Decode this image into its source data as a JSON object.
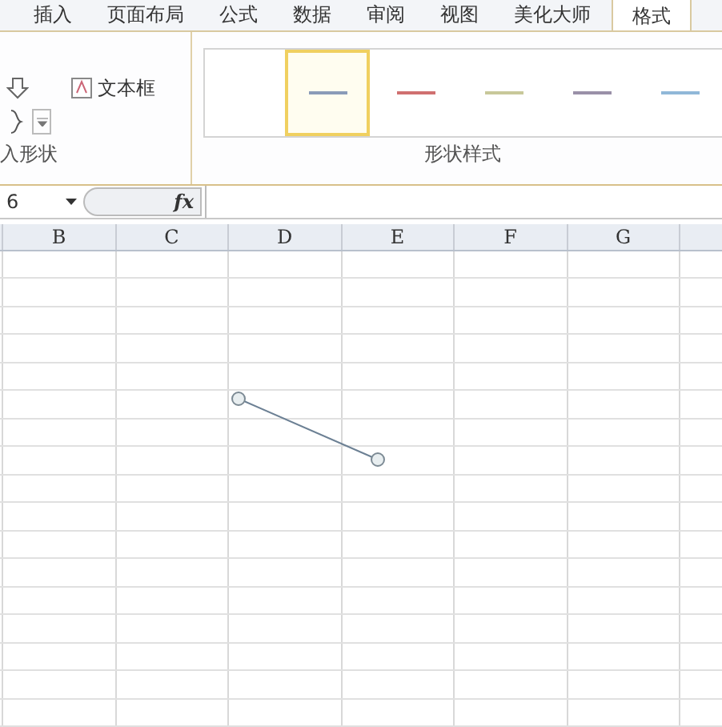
{
  "tabs": [
    {
      "label": "插入",
      "selected": false
    },
    {
      "label": "页面布局",
      "selected": false
    },
    {
      "label": "公式",
      "selected": false
    },
    {
      "label": "数据",
      "selected": false
    },
    {
      "label": "审阅",
      "selected": false
    },
    {
      "label": "视图",
      "selected": false
    },
    {
      "label": "美化大师",
      "selected": false
    },
    {
      "label": "格式",
      "selected": true
    }
  ],
  "insert_shapes": {
    "text_box_button": "文本框",
    "group_label": "入形状"
  },
  "shape_styles": {
    "items": [
      {
        "color": "#8a9bb8",
        "selected": true
      },
      {
        "color": "#d07070",
        "selected": false
      },
      {
        "color": "#c8c89a",
        "selected": false
      },
      {
        "color": "#9a90a8",
        "selected": false
      },
      {
        "color": "#90b8d8",
        "selected": false
      }
    ],
    "group_label": "形状样式"
  },
  "formula_bar": {
    "name_box": "6",
    "fx": "fx"
  },
  "columns": [
    "B",
    "C",
    "D",
    "E",
    "F",
    "G"
  ]
}
